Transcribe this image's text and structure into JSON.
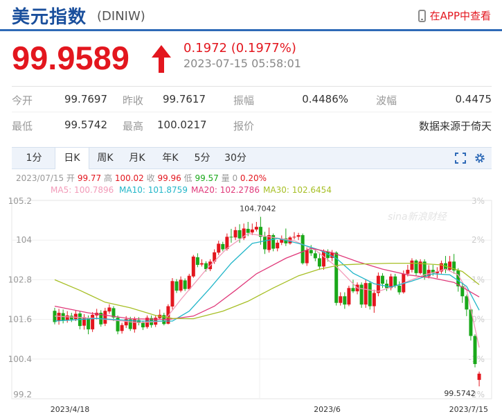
{
  "header": {
    "title": "美元指数",
    "code": "(DINIW)",
    "app_link": "在APP中查看"
  },
  "quote": {
    "price": "99.9589",
    "change": "0.1972 (0.1977%)",
    "time": "2023-07-15 05:58:01",
    "up_color": "#e3161e"
  },
  "stats": {
    "row1": [
      {
        "label": "今开",
        "value": "99.7697"
      },
      {
        "label": "昨收",
        "value": "99.7617"
      },
      {
        "label": "振幅",
        "value": "0.4486%"
      },
      {
        "label": "波幅",
        "value": "0.4475"
      }
    ],
    "row2": [
      {
        "label": "最低",
        "value": "99.5742"
      },
      {
        "label": "最高",
        "value": "100.0217"
      },
      {
        "label": "报价",
        "value": ""
      },
      {
        "label": "",
        "value": "数据来源于倚天"
      }
    ]
  },
  "tabs": [
    "1分",
    "日K",
    "周K",
    "月K",
    "年K",
    "5分",
    "30分"
  ],
  "active_tab": "日K",
  "info_line": {
    "date": "2023/07/15",
    "open_label": "开",
    "open": "99.77",
    "high_label": "高",
    "high": "100.02",
    "close_label": "收",
    "close": "99.96",
    "low_label": "低",
    "low": "99.57",
    "vol_label": "量",
    "vol": "0",
    "pct": "0.20%"
  },
  "ma_legend": [
    {
      "text": "MA5: 100.7896",
      "color": "#f29ab8"
    },
    {
      "text": "MA10: 101.8759",
      "color": "#22b6c9"
    },
    {
      "text": "MA20: 102.2786",
      "color": "#e0397a"
    },
    {
      "text": "MA30: 102.6454",
      "color": "#a7bf25"
    }
  ],
  "watermark": "sina新浪财经",
  "chart_data": {
    "type": "candlestick",
    "ylim": [
      99.2,
      105.2
    ],
    "y_ticks": [
      "105.2",
      "104",
      "102.8",
      "101.6",
      "100.4",
      "99.2"
    ],
    "y_ticks_right": [
      "3%",
      "2%",
      "1%",
      "0%",
      "-1%",
      "-2%"
    ],
    "x_labels": [
      {
        "index": 0,
        "label": "2023/4/18"
      },
      {
        "index": 50,
        "label": "2023/6"
      },
      {
        "index": 101,
        "label": "2023/7/15"
      }
    ],
    "annotations": [
      {
        "index": 49,
        "value": 104.7042,
        "label": "104.7042",
        "pos": "top"
      },
      {
        "index": 101,
        "value": 99.5742,
        "label": "99.5742",
        "pos": "bottom"
      }
    ],
    "candles": [
      [
        101.86,
        101.52,
        101.95,
        101.45
      ],
      [
        101.56,
        101.8,
        101.92,
        101.44
      ],
      [
        101.79,
        101.57,
        101.9,
        101.48
      ],
      [
        101.58,
        101.72,
        101.85,
        101.5
      ],
      [
        101.71,
        101.6,
        101.8,
        101.52
      ],
      [
        101.61,
        101.77,
        101.88,
        101.55
      ],
      [
        101.78,
        101.4,
        101.85,
        101.3
      ],
      [
        101.41,
        101.67,
        101.76,
        101.29
      ],
      [
        101.65,
        101.3,
        101.72,
        101.15
      ],
      [
        101.3,
        101.74,
        101.82,
        101.22
      ],
      [
        101.72,
        101.8,
        101.92,
        101.6
      ],
      [
        101.8,
        101.45,
        101.88,
        101.38
      ],
      [
        101.47,
        101.86,
        101.95,
        101.4
      ],
      [
        101.84,
        101.96,
        102.06,
        101.77
      ],
      [
        101.94,
        101.66,
        102.0,
        101.55
      ],
      [
        101.65,
        101.24,
        101.72,
        101.15
      ],
      [
        101.25,
        101.43,
        101.5,
        101.17
      ],
      [
        101.42,
        101.61,
        101.7,
        101.34
      ],
      [
        101.6,
        101.31,
        101.68,
        101.25
      ],
      [
        101.3,
        101.6,
        101.68,
        101.2
      ],
      [
        101.58,
        101.5,
        101.67,
        101.42
      ],
      [
        101.5,
        101.36,
        101.55,
        101.28
      ],
      [
        101.37,
        101.65,
        101.72,
        101.32
      ],
      [
        101.64,
        101.43,
        101.72,
        101.35
      ],
      [
        101.44,
        101.65,
        101.72,
        101.37
      ],
      [
        101.64,
        101.74,
        101.9,
        101.6
      ],
      [
        101.73,
        101.46,
        101.8,
        101.42
      ],
      [
        101.47,
        102.0,
        102.06,
        101.45
      ],
      [
        101.99,
        102.76,
        102.85,
        101.9
      ],
      [
        102.75,
        102.47,
        102.82,
        102.4
      ],
      [
        102.47,
        102.8,
        102.9,
        102.42
      ],
      [
        102.78,
        102.52,
        102.84,
        102.46
      ],
      [
        102.52,
        102.92,
        102.98,
        102.48
      ],
      [
        102.9,
        103.5,
        103.55,
        102.86
      ],
      [
        103.48,
        103.25,
        103.6,
        103.18
      ],
      [
        103.26,
        103.3,
        103.42,
        103.2
      ],
      [
        103.3,
        103.12,
        103.36,
        103.05
      ],
      [
        103.12,
        103.35,
        103.42,
        103.06
      ],
      [
        103.35,
        103.63,
        103.72,
        103.28
      ],
      [
        103.62,
        103.89,
        103.98,
        103.55
      ],
      [
        103.88,
        103.72,
        103.95,
        103.66
      ],
      [
        103.73,
        104.1,
        104.2,
        103.68
      ],
      [
        104.1,
        104.08,
        104.34,
        103.92
      ],
      [
        104.08,
        104.3,
        104.4,
        104.0
      ],
      [
        104.3,
        104.05,
        104.48,
        103.92
      ],
      [
        104.06,
        104.35,
        104.5,
        104.0
      ],
      [
        104.34,
        104.22,
        104.55,
        104.12
      ],
      [
        104.23,
        104.32,
        104.5,
        104.15
      ],
      [
        104.32,
        104.4,
        104.55,
        104.26
      ],
      [
        104.4,
        104.1,
        104.7042,
        103.86
      ],
      [
        104.1,
        103.72,
        104.25,
        103.58
      ],
      [
        103.7,
        104.15,
        104.38,
        103.62
      ],
      [
        104.15,
        103.74,
        104.2,
        103.66
      ],
      [
        103.75,
        103.92,
        104.0,
        103.66
      ],
      [
        103.92,
        104.05,
        104.14,
        103.85
      ],
      [
        104.05,
        103.9,
        104.35,
        103.82
      ],
      [
        103.9,
        104.08,
        104.12,
        103.86
      ],
      [
        104.08,
        104.1,
        104.24,
        104.02
      ],
      [
        104.1,
        104.15,
        104.22,
        104.0
      ],
      [
        104.15,
        103.3,
        104.2,
        103.26
      ],
      [
        103.3,
        103.7,
        103.78,
        103.22
      ],
      [
        103.7,
        103.6,
        103.85,
        103.52
      ],
      [
        103.6,
        103.45,
        103.75,
        103.36
      ],
      [
        103.45,
        103.2,
        103.62,
        103.1
      ],
      [
        103.2,
        103.65,
        103.72,
        103.1
      ],
      [
        103.65,
        103.46,
        103.72,
        103.35
      ],
      [
        103.46,
        103.62,
        103.7,
        103.36
      ],
      [
        103.62,
        102.1,
        103.66,
        102.02
      ],
      [
        102.1,
        102.3,
        102.42,
        102.02
      ],
      [
        102.3,
        102.05,
        102.42,
        101.92
      ],
      [
        102.05,
        102.55,
        102.62,
        102.0
      ],
      [
        102.55,
        102.45,
        102.8,
        102.4
      ],
      [
        102.45,
        102.65,
        102.72,
        102.36
      ],
      [
        102.65,
        102.05,
        102.72,
        101.95
      ],
      [
        102.05,
        102.7,
        102.8,
        101.95
      ],
      [
        102.7,
        102.0,
        102.76,
        101.9
      ],
      [
        102.0,
        102.4,
        102.5,
        101.8
      ],
      [
        102.4,
        102.92,
        103.02,
        102.3
      ],
      [
        102.92,
        102.68,
        103.0,
        102.55
      ],
      [
        102.68,
        102.55,
        102.8,
        102.46
      ],
      [
        102.55,
        102.9,
        102.98,
        102.48
      ],
      [
        102.9,
        102.62,
        102.98,
        102.55
      ],
      [
        102.62,
        102.42,
        102.75,
        102.35
      ],
      [
        102.42,
        102.98,
        103.08,
        102.38
      ],
      [
        102.98,
        103.1,
        103.25,
        102.9
      ],
      [
        103.1,
        103.38,
        103.45,
        103.02
      ],
      [
        103.38,
        103.0,
        103.42,
        102.92
      ],
      [
        103.0,
        103.35,
        103.42,
        102.96
      ],
      [
        103.35,
        102.9,
        103.42,
        102.8
      ],
      [
        102.9,
        103.1,
        103.24,
        102.84
      ],
      [
        103.1,
        103.0,
        103.25,
        102.92
      ],
      [
        103.0,
        103.05,
        103.18,
        102.85
      ],
      [
        103.05,
        103.3,
        103.38,
        102.98
      ],
      [
        103.3,
        103.1,
        103.52,
        103.0
      ],
      [
        103.1,
        103.35,
        103.52,
        103.05
      ],
      [
        103.35,
        103.08,
        103.58,
        102.98
      ],
      [
        103.08,
        102.6,
        103.15,
        102.44
      ],
      [
        102.6,
        102.3,
        102.7,
        102.1
      ],
      [
        102.3,
        101.9,
        102.35,
        101.7
      ],
      [
        101.9,
        101.1,
        101.95,
        100.96
      ],
      [
        101.1,
        100.25,
        101.15,
        100.15
      ],
      [
        99.77,
        99.9589,
        100.0217,
        99.5742
      ]
    ],
    "ma_lines": [
      {
        "name": "MA5",
        "color": "#f29ab8",
        "points": [
          [
            0,
            101.7
          ],
          [
            10,
            101.63
          ],
          [
            20,
            101.5
          ],
          [
            26,
            101.55
          ],
          [
            30,
            102.2
          ],
          [
            36,
            103.1
          ],
          [
            41,
            103.75
          ],
          [
            46,
            104.2
          ],
          [
            51,
            104.1
          ],
          [
            57,
            103.98
          ],
          [
            62,
            103.7
          ],
          [
            67,
            103.2
          ],
          [
            72,
            102.55
          ],
          [
            77,
            102.45
          ],
          [
            82,
            102.65
          ],
          [
            88,
            102.95
          ],
          [
            93,
            103.12
          ],
          [
            96,
            102.95
          ],
          [
            98,
            102.5
          ],
          [
            101,
            100.75
          ]
        ]
      },
      {
        "name": "MA10",
        "color": "#22b6c9",
        "points": [
          [
            0,
            101.55
          ],
          [
            10,
            101.63
          ],
          [
            20,
            101.55
          ],
          [
            28,
            101.55
          ],
          [
            32,
            101.85
          ],
          [
            37,
            102.55
          ],
          [
            42,
            103.3
          ],
          [
            47,
            103.9
          ],
          [
            53,
            104.05
          ],
          [
            58,
            103.9
          ],
          [
            63,
            103.7
          ],
          [
            67,
            103.45
          ],
          [
            71,
            103.0
          ],
          [
            76,
            102.68
          ],
          [
            80,
            102.58
          ],
          [
            85,
            102.76
          ],
          [
            90,
            102.98
          ],
          [
            94,
            102.95
          ],
          [
            98,
            102.6
          ],
          [
            101,
            101.88
          ]
        ]
      },
      {
        "name": "MA20",
        "color": "#e0397a",
        "points": [
          [
            0,
            102.0
          ],
          [
            8,
            101.8
          ],
          [
            18,
            101.62
          ],
          [
            27,
            101.6
          ],
          [
            33,
            101.7
          ],
          [
            38,
            102.0
          ],
          [
            43,
            102.48
          ],
          [
            48,
            102.98
          ],
          [
            55,
            103.45
          ],
          [
            61,
            103.75
          ],
          [
            66,
            103.62
          ],
          [
            72,
            103.35
          ],
          [
            78,
            103.12
          ],
          [
            84,
            102.95
          ],
          [
            90,
            102.85
          ],
          [
            95,
            102.72
          ],
          [
            101,
            102.28
          ]
        ]
      },
      {
        "name": "MA30",
        "color": "#a7bf25",
        "points": [
          [
            0,
            102.8
          ],
          [
            6,
            102.48
          ],
          [
            12,
            102.12
          ],
          [
            18,
            101.95
          ],
          [
            24,
            101.72
          ],
          [
            28,
            101.63
          ],
          [
            33,
            101.62
          ],
          [
            40,
            101.85
          ],
          [
            46,
            102.15
          ],
          [
            52,
            102.55
          ],
          [
            58,
            102.92
          ],
          [
            63,
            103.12
          ],
          [
            68,
            103.25
          ],
          [
            74,
            103.28
          ],
          [
            80,
            103.3
          ],
          [
            86,
            103.3
          ],
          [
            92,
            103.25
          ],
          [
            97,
            103.05
          ],
          [
            101,
            102.65
          ]
        ]
      }
    ]
  }
}
